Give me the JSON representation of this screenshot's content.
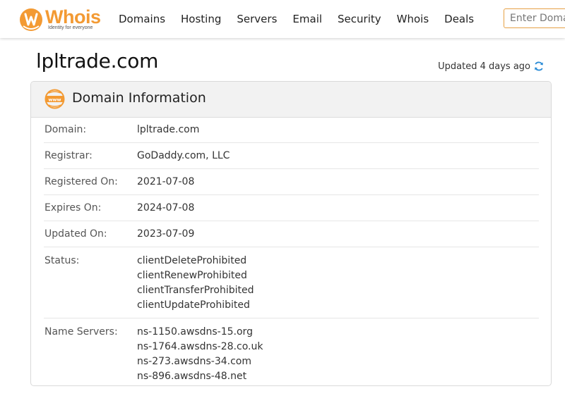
{
  "header": {
    "logo": {
      "word_highlight": "Wh",
      "word_rest": "ois",
      "tagline": "Identity for everyone"
    },
    "nav": [
      "Domains",
      "Hosting",
      "Servers",
      "Email",
      "Security",
      "Whois",
      "Deals"
    ],
    "search": {
      "placeholder": "Enter Domain"
    }
  },
  "page": {
    "title": "lpltrade.com",
    "updated_text": "Updated 4 days ago"
  },
  "card": {
    "title": "Domain Information",
    "rows": [
      {
        "label": "Domain:",
        "value": "lpltrade.com"
      },
      {
        "label": "Registrar:",
        "value": "GoDaddy.com, LLC"
      },
      {
        "label": "Registered On:",
        "value": "2021-07-08"
      },
      {
        "label": "Expires On:",
        "value": "2024-07-08"
      },
      {
        "label": "Updated On:",
        "value": "2023-07-09"
      }
    ],
    "status": {
      "label": "Status:",
      "values": [
        "clientDeleteProhibited",
        "clientRenewProhibited",
        "clientTransferProhibited",
        "clientUpdateProhibited"
      ]
    },
    "name_servers": {
      "label": "Name Servers:",
      "values": [
        "ns-1150.awsdns-15.org",
        "ns-1764.awsdns-28.co.uk",
        "ns-273.awsdns-34.com",
        "ns-896.awsdns-48.net"
      ]
    }
  },
  "colors": {
    "brand_orange": "#f39a33",
    "refresh_blue": "#2a8bd6"
  }
}
